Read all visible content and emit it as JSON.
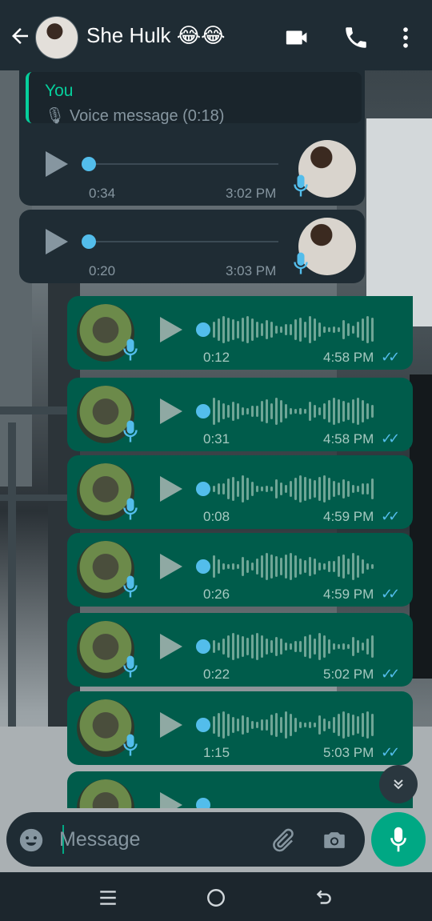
{
  "header": {
    "title": "She Hulk 😂😂",
    "icons": [
      "back-arrow-icon",
      "video-call-icon",
      "voice-call-icon",
      "more-options-icon"
    ]
  },
  "reply": {
    "name": "You",
    "text": "🎙 Voice message (0:18)"
  },
  "messages": [
    {
      "direction": "in",
      "duration": "0:34",
      "time": "3:02 PM"
    },
    {
      "direction": "in",
      "duration": "0:20",
      "time": "3:03 PM"
    },
    {
      "direction": "out",
      "duration": "0:12",
      "time": "4:58 PM",
      "ticks": "✓✓"
    },
    {
      "direction": "out",
      "duration": "0:31",
      "time": "4:58 PM",
      "ticks": "✓✓"
    },
    {
      "direction": "out",
      "duration": "0:08",
      "time": "4:59 PM",
      "ticks": "✓✓"
    },
    {
      "direction": "out",
      "duration": "0:26",
      "time": "4:59 PM",
      "ticks": "✓✓"
    },
    {
      "direction": "out",
      "duration": "0:22",
      "time": "5:02 PM",
      "ticks": "✓✓"
    },
    {
      "direction": "out",
      "duration": "1:15",
      "time": "5:03 PM",
      "ticks": "✓✓"
    }
  ],
  "input": {
    "placeholder": "Message"
  },
  "colors": {
    "header": "#1f2c34",
    "incoming": "#1f2c34",
    "outgoing": "#005c4b",
    "accent": "#00a884",
    "seek": "#53bdeb"
  }
}
